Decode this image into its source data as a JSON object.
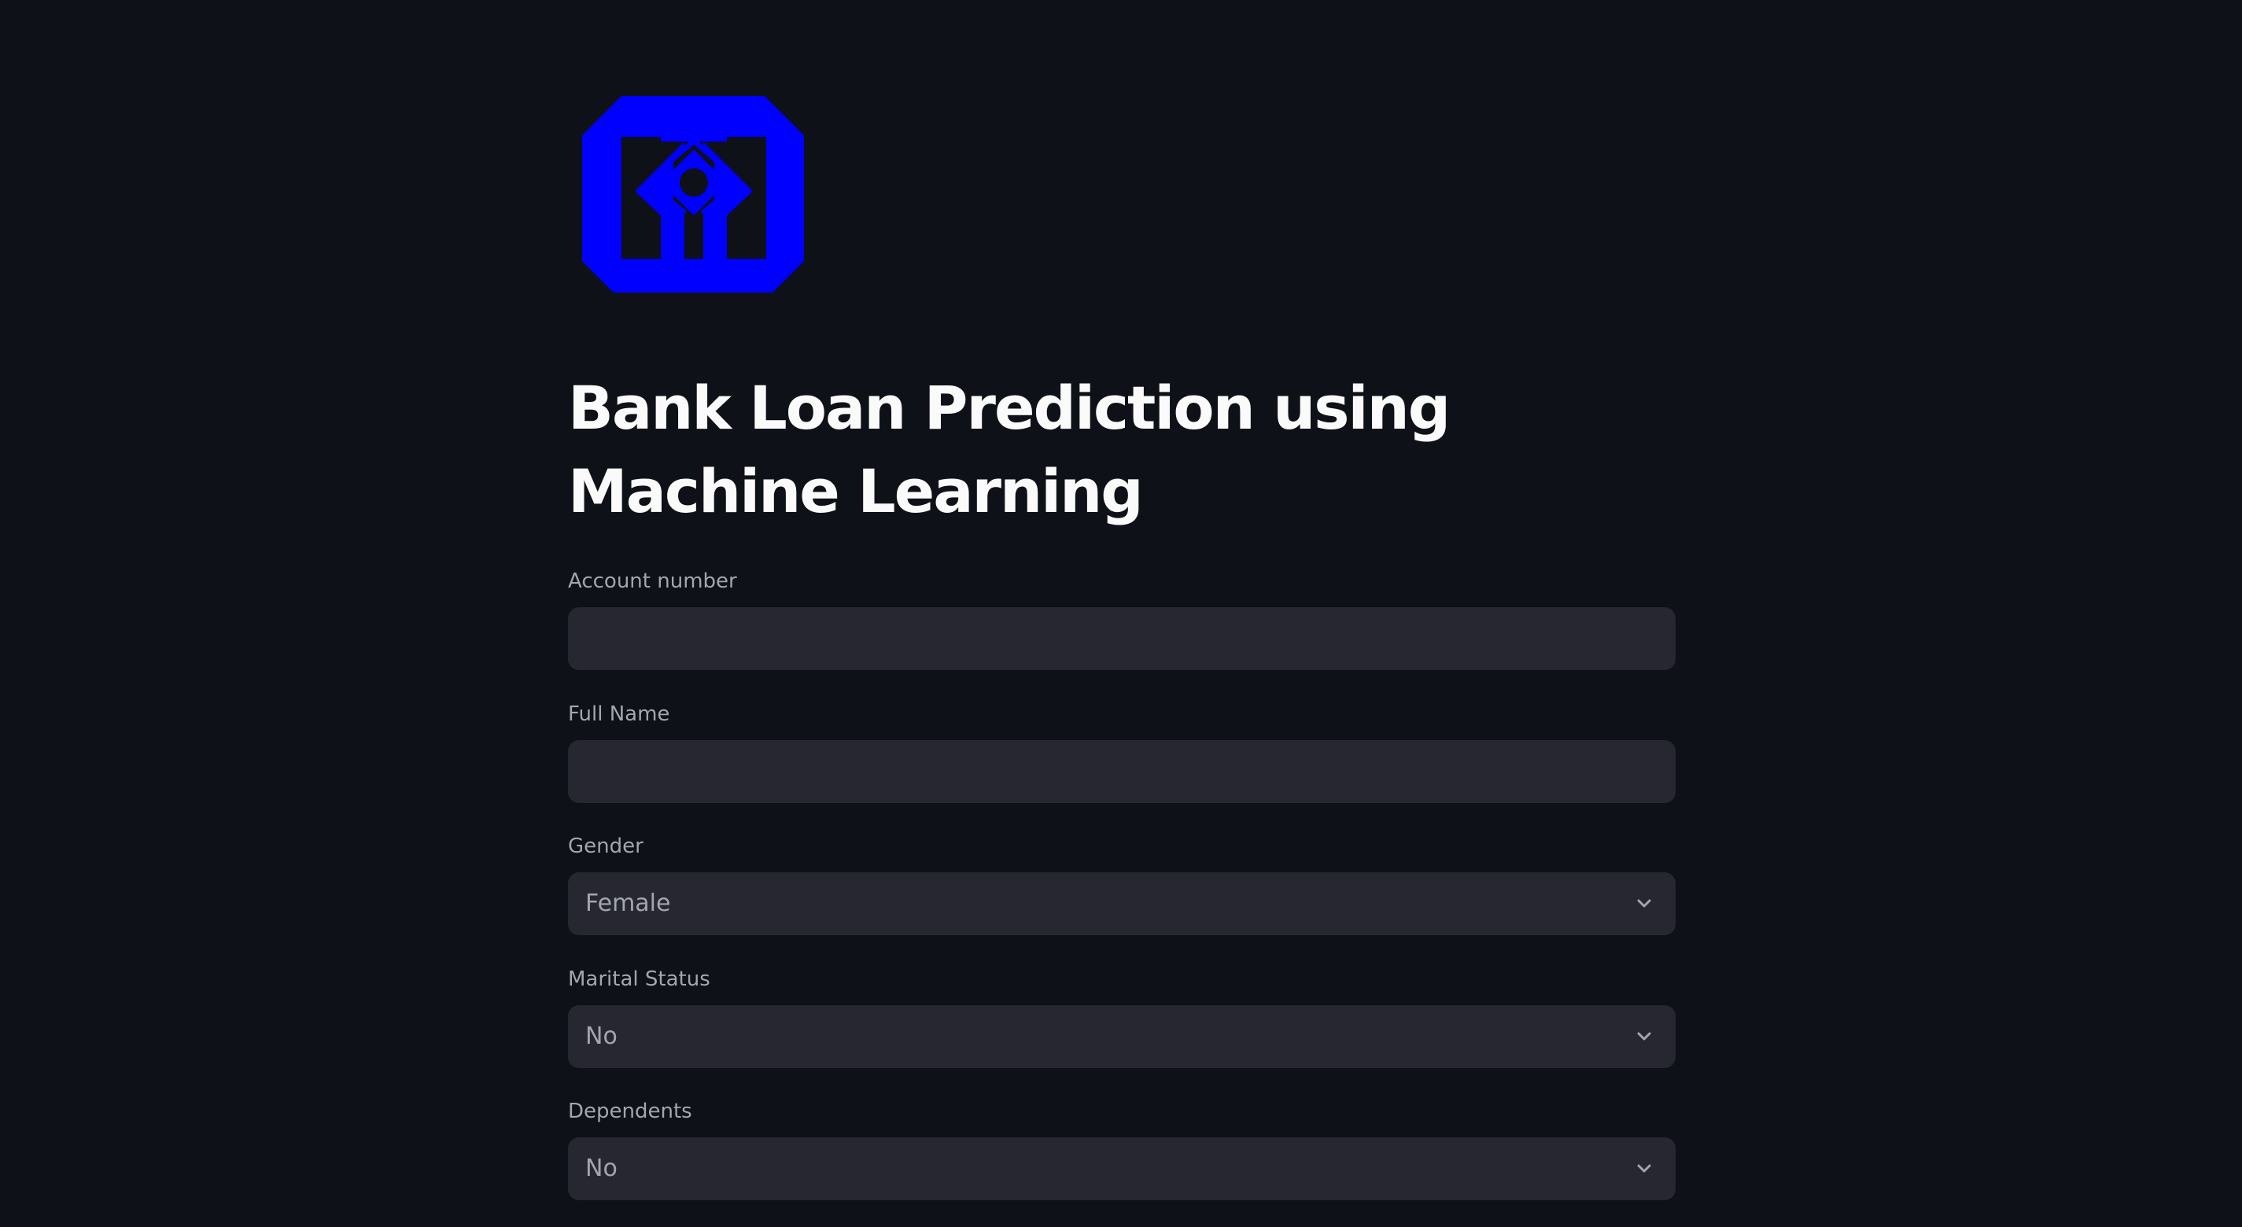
{
  "app": {
    "title": "Bank Loan Prediction using Machine Learning",
    "logo_icon": "bank-logo-icon",
    "logo_color": "#0000ff"
  },
  "form": {
    "account_number": {
      "label": "Account number",
      "value": ""
    },
    "full_name": {
      "label": "Full Name",
      "value": ""
    },
    "gender": {
      "label": "Gender",
      "value": "Female"
    },
    "marital_status": {
      "label": "Marital Status",
      "value": "No"
    },
    "dependents": {
      "label": "Dependents",
      "value": "No"
    }
  },
  "colors": {
    "background": "#0e1117",
    "input_background": "#262730",
    "label": "#a3a6ad",
    "text": "#fafafa"
  }
}
